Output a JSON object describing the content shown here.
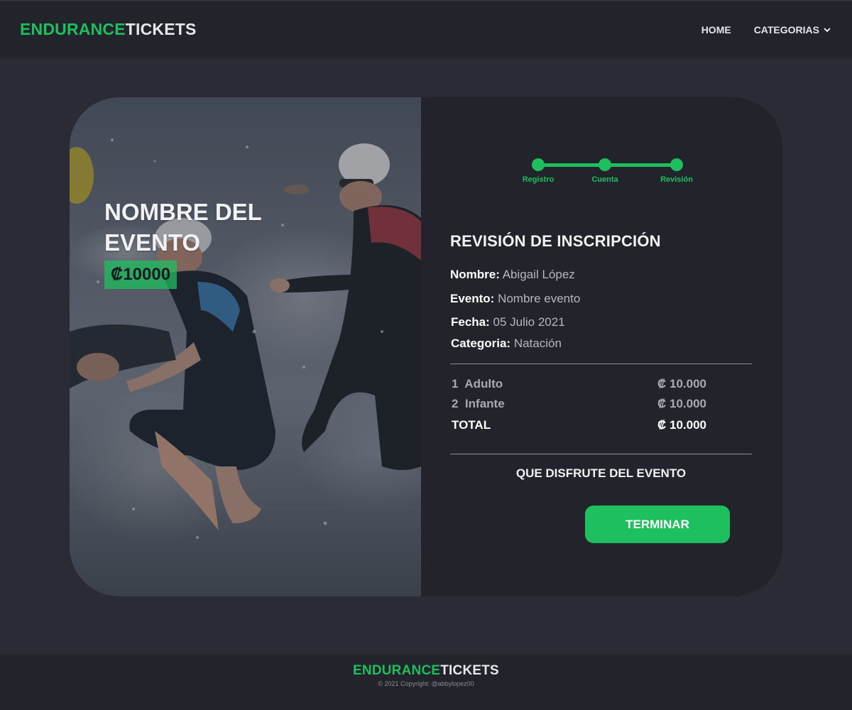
{
  "brand": {
    "part1": "ENDURANCE",
    "part2": "TICKETS"
  },
  "nav": {
    "home": "HOME",
    "categories": "CATEGORIAS"
  },
  "event": {
    "title": "NOMBRE DEL EVENTO",
    "price": "₡10000"
  },
  "stepper": {
    "steps": [
      "Registro",
      "Cuenta",
      "Revisión"
    ]
  },
  "review": {
    "heading": "REVISIÓN DE INSCRIPCIÓN",
    "name_label": "Nombre:",
    "name_value": "Abigail López",
    "event_label": "Evento:",
    "event_value": "Nombre evento",
    "date_label": "Fecha:",
    "date_value": "05 Julio 2021",
    "category_label": "Categoria:",
    "category_value": "Natación",
    "items": [
      {
        "qty": "1",
        "label": "Adulto",
        "amount": "₡ 10.000"
      },
      {
        "qty": "2",
        "label": "Infante",
        "amount": "₡ 10.000"
      }
    ],
    "total_label": "TOTAL",
    "total_amount": "₡ 10.000",
    "thanks": "QUE DISFRUTE DEL EVENTO",
    "finish_button": "TERMINAR"
  },
  "footer": {
    "copyright": "© 2021 Copyright: @abbylopez00"
  },
  "colors": {
    "accent": "#1dbf5e",
    "background": "#2a2b34",
    "panel": "#22232b"
  }
}
